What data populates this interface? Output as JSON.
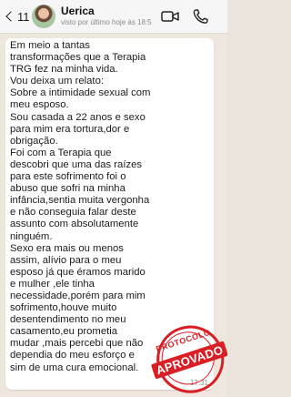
{
  "header": {
    "back_count": "11",
    "contact_name": "Uerica",
    "contact_status": "visto por último hoje às 18:5"
  },
  "message": {
    "text": "Em meio a tantas\ntransformações que a Terapia\nTRG fez na minha vida.\nVou deixa um relato:\nSobre a intimidade sexual com\nmeu esposo.\nSou casada a 22 anos e sexo\npara mim era tortura,dor e\nobrigação.\nFoi com a Terapia que\ndescobri que uma das raízes\npara este sofrimento foi o\nabuso que sofri na minha\ninfância,sentia muita vergonha\ne não conseguia falar deste\nassunto com absolutamente\nninguém.\nSexo era mais ou menos\nassim,  alívio para  o meu\nesposo já que éramos marido\ne mulher ,ele tinha\nnecessidade,porém para mim\nsofrimento,houve muito\ndesentendimento no meu\ncasamento,eu prometia\nmudar ,mais percebi que não\ndependia do meu esforço e\nsim de uma cura emocional.",
    "time": "17:31"
  },
  "stamp": {
    "top_text": "PROTOCOLO",
    "band_text": "APROVADO",
    "color": "#d91f25"
  },
  "icons": {
    "back": "chevron-left-icon",
    "video": "video-camera-icon",
    "phone": "phone-icon"
  }
}
